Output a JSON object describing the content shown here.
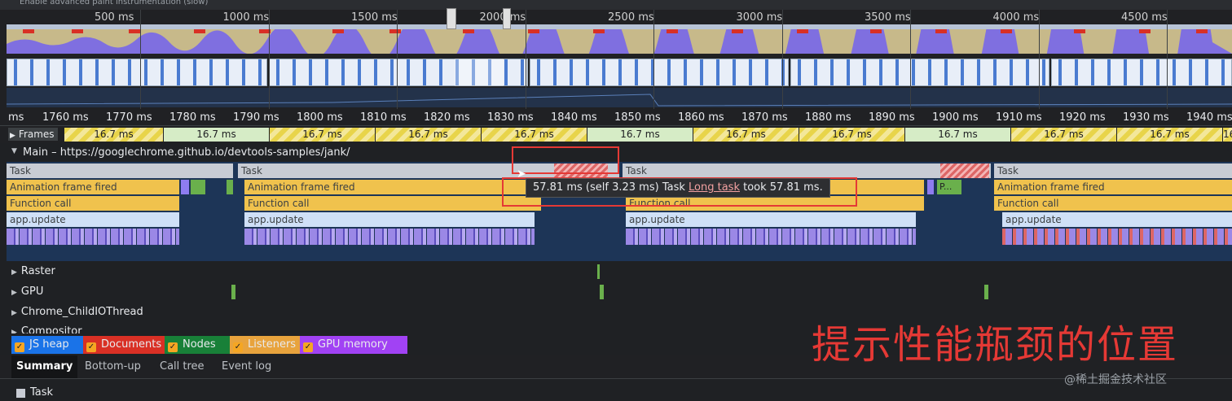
{
  "overview": {
    "top_text": "Enable advanced paint instrumentation (slow)",
    "ticks": [
      "500 ms",
      "1000 ms",
      "1500 ms",
      "2000 ms",
      "2500 ms",
      "3000 ms",
      "3500 ms",
      "4000 ms",
      "4500 ms"
    ]
  },
  "ruler": {
    "ticks": [
      "ms",
      "1760 ms",
      "1770 ms",
      "1780 ms",
      "1790 ms",
      "1800 ms",
      "1810 ms",
      "1820 ms",
      "1830 ms",
      "1840 ms",
      "1850 ms",
      "1860 ms",
      "1870 ms",
      "1880 ms",
      "1890 ms",
      "1900 ms",
      "1910 ms",
      "1920 ms",
      "1930 ms",
      "1940 ms"
    ]
  },
  "frames": {
    "label": "Frames",
    "values": [
      "16.7 ms",
      "16.7 ms",
      "16.7 ms",
      "16.7 ms",
      "16.7 ms",
      "16.7 ms",
      "16.7 ms",
      "16.7 ms",
      "16.7 ms",
      "16.7 ms",
      "16.7 ms",
      "16.7 ms"
    ]
  },
  "main": {
    "title": "Main – https://googlechrome.github.io/devtools-samples/jank/",
    "task": "Task",
    "animation_frame": "Animation frame fired",
    "function_call": "Function call",
    "app_update": "app.update",
    "p_label": "P..."
  },
  "tooltip": {
    "time": "57.81 ms (self 3.23 ms)",
    "name": "Task",
    "link": "Long task",
    "suffix": "took 57.81 ms."
  },
  "tracks": [
    "Raster",
    "GPU",
    "Chrome_ChildIOThread",
    "Compositor"
  ],
  "counters": [
    {
      "label": "JS heap",
      "color": "#1a73e8"
    },
    {
      "label": "Documents",
      "color": "#d93025"
    },
    {
      "label": "Nodes",
      "color": "#188038"
    },
    {
      "label": "Listeners",
      "color": "#e8a33d"
    },
    {
      "label": "GPU memory",
      "color": "#a142f4"
    }
  ],
  "tabs": [
    "Summary",
    "Bottom-up",
    "Call tree",
    "Event log"
  ],
  "summary": {
    "item": "Task"
  },
  "caption": "提示性能瓶颈的位置",
  "watermark": "@稀土掘金技术社区"
}
